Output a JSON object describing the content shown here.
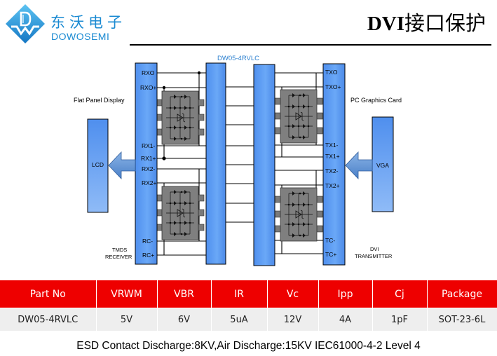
{
  "brand": {
    "name_cn": "东沃电子",
    "name_en": "DOWOSEMI",
    "logo_icon": "dw-diamond-logo",
    "accent_color": "#1a8ad2"
  },
  "header": {
    "title_bold": "DVI",
    "title_rest": "接口保护"
  },
  "diagram": {
    "chip_label": "DW05-4RVLC",
    "left_caption": "Flat Panel Display",
    "right_caption": "PC Graphics Card",
    "lcd_label": "LCD",
    "vga_label": "VGA",
    "receiver_caption": [
      "TMDS",
      "RECEIVER"
    ],
    "transmitter_caption": [
      "DVI",
      "TRANSMITTER"
    ],
    "receiver_pins": [
      "RXO",
      "RXO+",
      "RX1-",
      "RX1+",
      "RX2-",
      "RX2+",
      "RC-",
      "RC+"
    ],
    "transmitter_pins": [
      "TXO",
      "TXO+",
      "TX1-",
      "TX1+",
      "TX2-",
      "TX2+",
      "TC-",
      "TC+"
    ],
    "block_color": "#5e9cf2",
    "tvs_package_color": "#7a7a7a"
  },
  "spec_table": {
    "header_color": "#ee0000",
    "columns": [
      "Part No",
      "VRWM",
      "VBR",
      "IR",
      "Vc",
      "Ipp",
      "Cj",
      "Package"
    ],
    "rows": [
      [
        "DW05-4RVLC",
        "5V",
        "6V",
        "5uA",
        "12V",
        "4A",
        "1pF",
        "SOT-23-6L"
      ]
    ]
  },
  "footer": {
    "note": "ESD Contact Discharge:8KV,Air Discharge:15KV  IEC61000-4-2 Level 4"
  }
}
